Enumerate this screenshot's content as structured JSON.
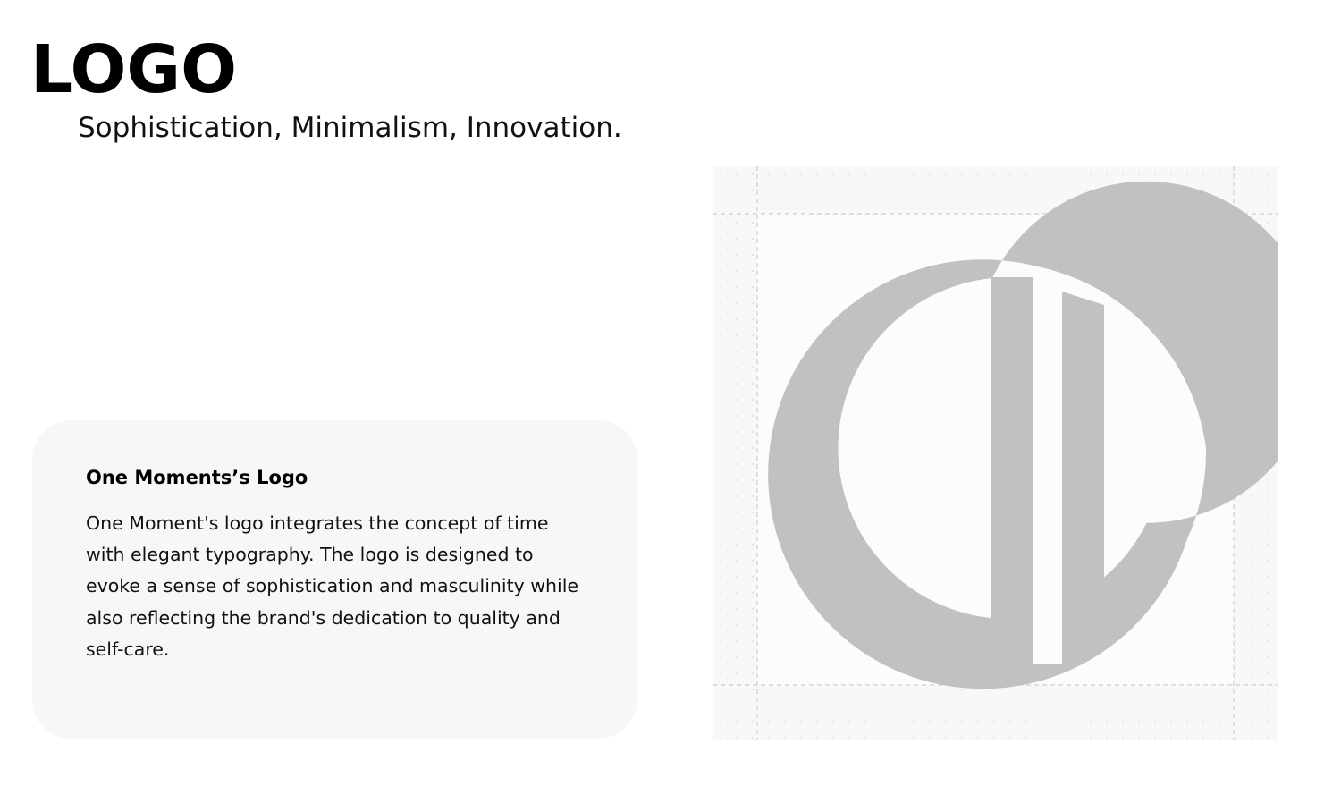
{
  "page": {
    "title": "LOGO",
    "subtitle": "Sophistication, Minimalism, Innovation."
  },
  "card": {
    "heading": "One Moments’s Logo",
    "body": "One Moment's logo integrates the concept of time with elegant typography. The logo is designed to evoke a sense of sophistication and masculinity while also reflecting the brand's dedication to quality and self-care."
  },
  "colors": {
    "background": "#ffffff",
    "card_background": "#f7f7f7",
    "logo_mark": "#c1c1c1",
    "panel_background": "#f8f8f8",
    "guide_lines": "#cfcfcf"
  },
  "icons": {
    "logo_mark": "one-moment-logo-icon"
  }
}
